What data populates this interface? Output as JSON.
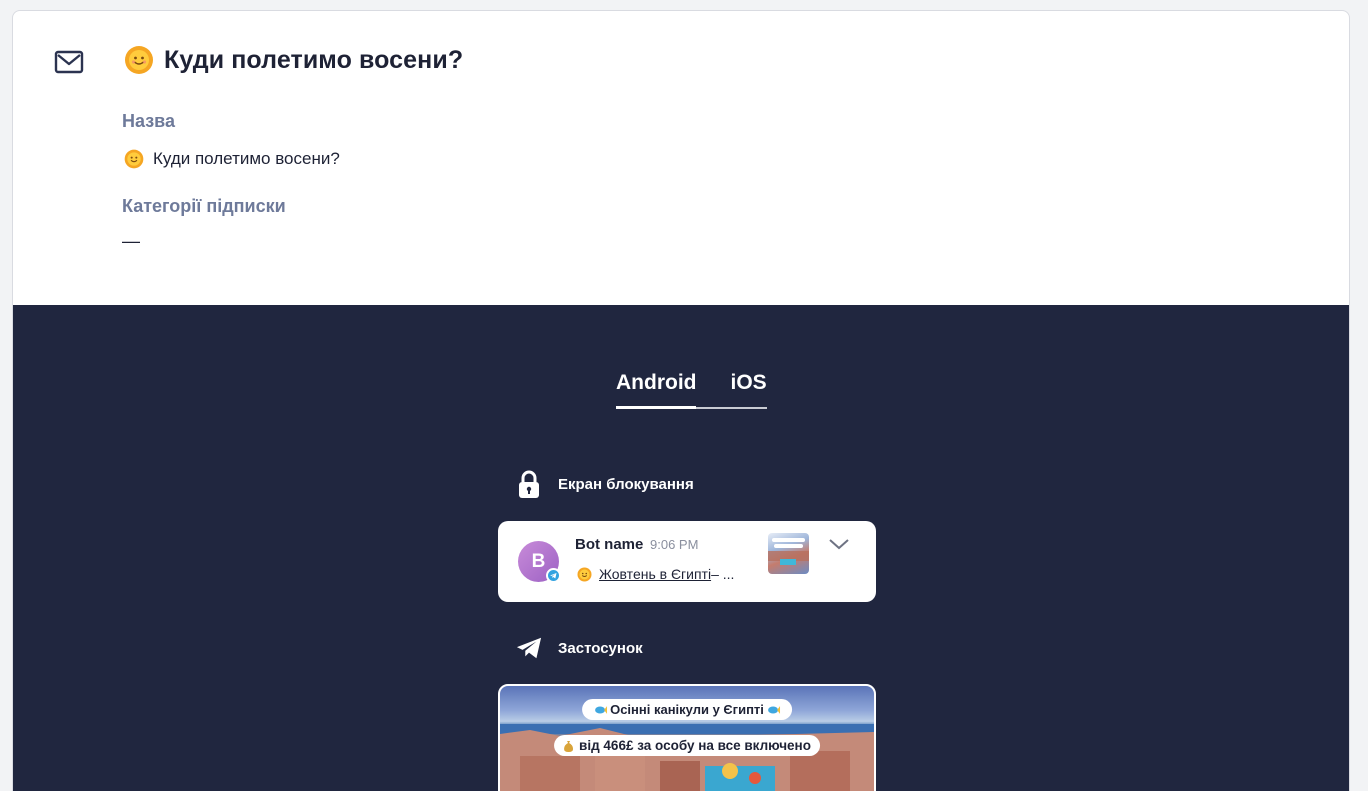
{
  "header": {
    "title": "Куди полетимо восени?"
  },
  "fields": {
    "name_label": "Назва",
    "name_value": "Куди полетимо восени?",
    "categories_label": "Категорії підписки",
    "categories_value": "—"
  },
  "preview": {
    "tabs": [
      {
        "label": "Android",
        "active": true
      },
      {
        "label": "iOS",
        "active": false
      }
    ],
    "lock_screen_label": "Екран блокування",
    "app_label": "Застосунок",
    "notification": {
      "avatar_letter": "B",
      "bot_name": "Bot name",
      "time": "9:06 PM",
      "link_text": "Жовтень в Єгипті ",
      "trailing_text": "– ..."
    },
    "app_card": {
      "line1": "Осінні канікули у Єгипті",
      "line2": "від 466£ за особу на все включено"
    }
  },
  "colors": {
    "preview_bg": "#20263f",
    "label_color": "#6e7a9a",
    "avatar": "#b777d0",
    "telegram": "#33a3e0"
  },
  "icons": [
    "mail-icon",
    "sun-emoji-icon",
    "lock-icon",
    "telegram-plane-icon",
    "chevron-down-icon",
    "fish-emoji-icon",
    "money-bag-emoji-icon"
  ]
}
